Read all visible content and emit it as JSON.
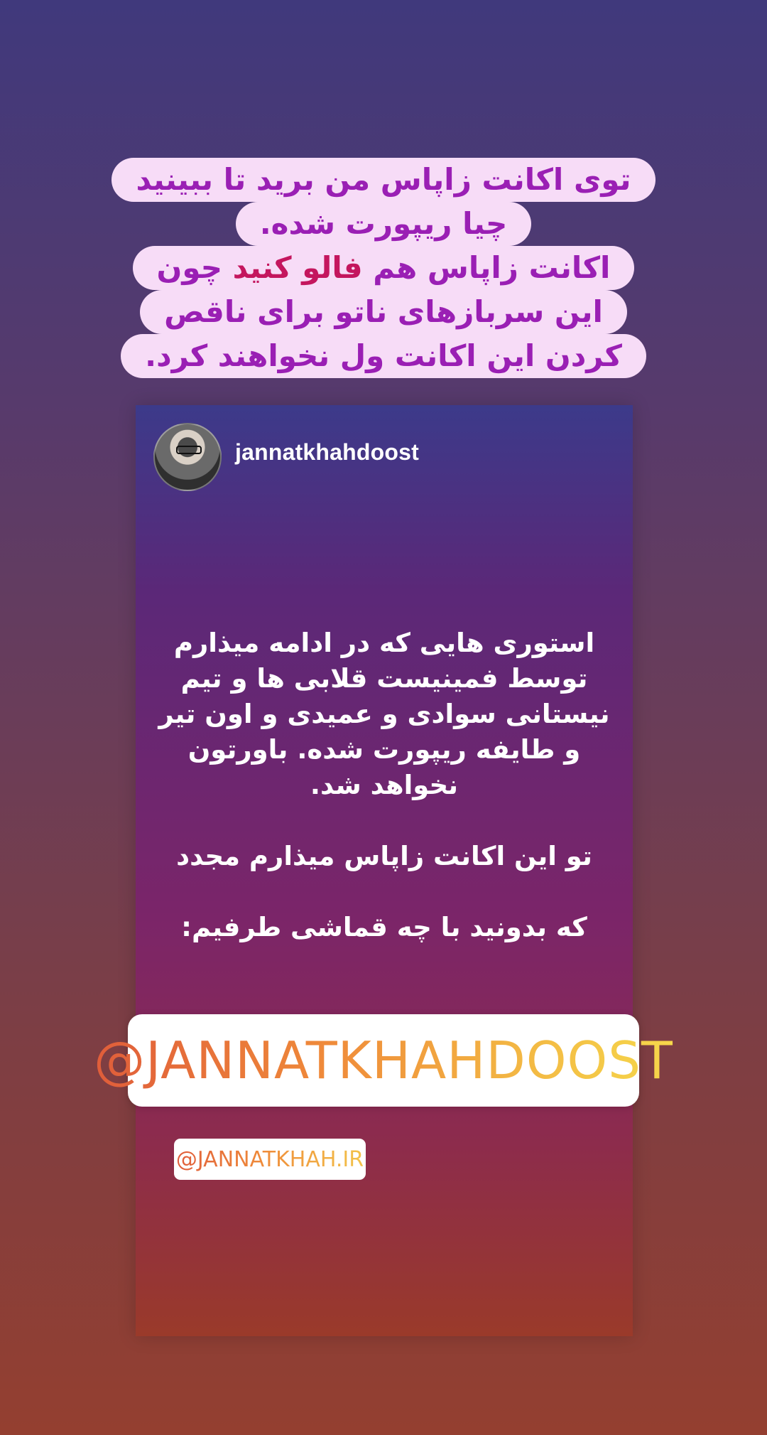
{
  "caption": {
    "line1": "توی اکانت زاپاس من برید تا ببینید",
    "line2": "چیا ریپورت شده.",
    "line3_a": "اکانت زاپاس هم",
    "line3_b": "فالو کنید",
    "line3_c": "چون",
    "line4": "این سربازهای ناتو برای ناقص",
    "line5": "کردن این اکانت ول نخواهند کرد."
  },
  "story": {
    "username": "jannatkhahdoost",
    "paragraph1": "استوری هایی که در ادامه میذارم\nتوسط فمینیست قلابی ها و تیم\nنیستانی سوادی و عمیدی و اون تیر\nو طایفه ریپورت شده. باورتون\nنخواهد شد.",
    "paragraph2": "تو این اکانت زاپاس میذارم مجدد",
    "paragraph3": "که بدونید با چه قماشی طرفیم:"
  },
  "mentions": {
    "primary": "@JANNATKHAHDOOST",
    "secondary": "@JANNATKHAH.IR"
  },
  "colors": {
    "caption_text": "#9a1fb4",
    "caption_highlight": "#c4165e",
    "caption_bg": "#f7dcf7"
  }
}
